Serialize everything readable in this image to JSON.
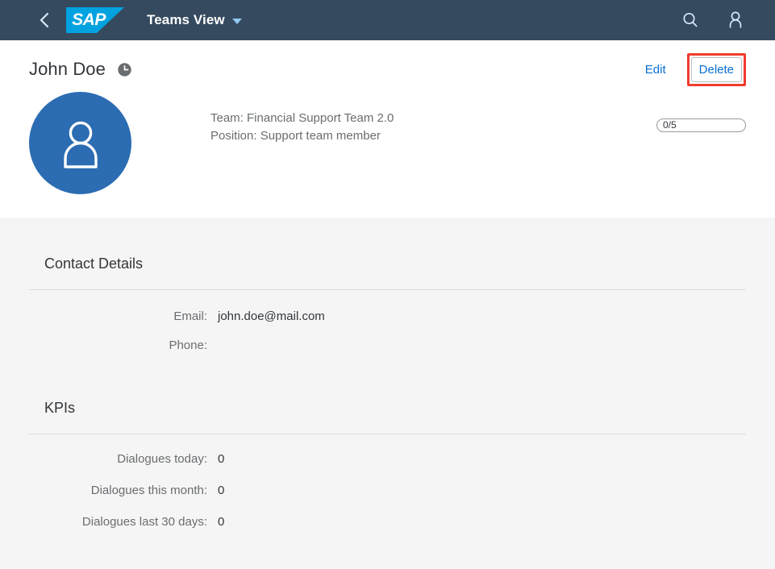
{
  "shell": {
    "back_icon": "chevron-left-icon",
    "logo_text": "SAP",
    "app_title": "Teams View",
    "dropdown_icon": "caret-down-icon",
    "search_icon": "search-icon",
    "user_icon": "user-icon",
    "background_color": "#354a5f",
    "logo_color": "#00a3e0"
  },
  "object_header": {
    "title": "John Doe",
    "status_icon": "clock-icon",
    "avatar_icon": "person-icon",
    "avatar_color": "#2b6cb2",
    "actions": {
      "edit_label": "Edit",
      "delete_label": "Delete",
      "highlight_color": "#f03c2e"
    },
    "facts": [
      "Team: Financial Support Team 2.0",
      "Position: Support team member"
    ],
    "progress": {
      "label": "0/5",
      "value": 0,
      "max": 5,
      "percent": 0
    }
  },
  "sections": [
    {
      "title": "Contact Details",
      "rows": [
        {
          "label": "Email:",
          "value": "john.doe@mail.com"
        },
        {
          "label": "Phone:",
          "value": ""
        }
      ]
    },
    {
      "title": "KPIs",
      "rows": [
        {
          "label": "Dialogues today:",
          "value": "0"
        },
        {
          "label": "Dialogues this month:",
          "value": "0"
        },
        {
          "label": "Dialogues last 30 days:",
          "value": "0"
        }
      ]
    }
  ]
}
